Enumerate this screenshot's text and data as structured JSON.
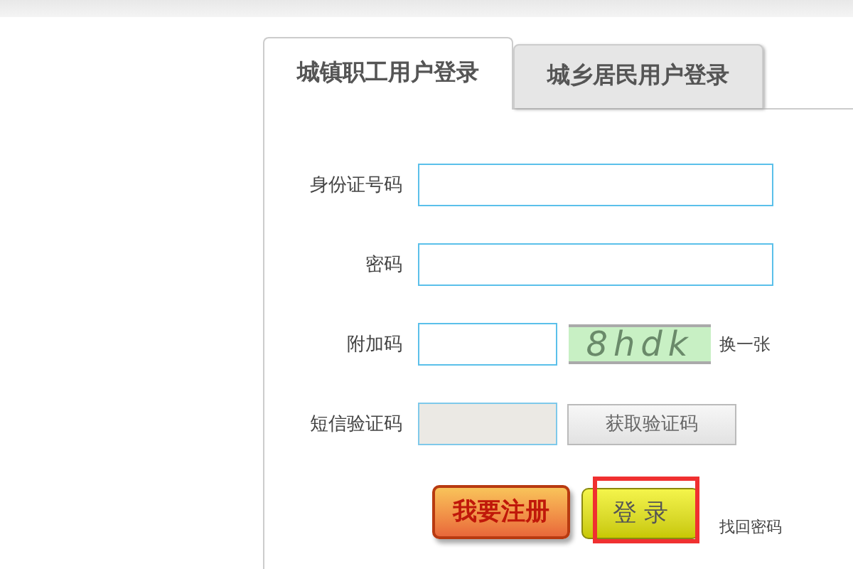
{
  "tabs": [
    {
      "label": "城镇职工用户登录",
      "selected": true
    },
    {
      "label": "城乡居民用户登录",
      "selected": false
    }
  ],
  "form": {
    "fields": [
      {
        "label": "身份证号码",
        "kind": "text",
        "disabled": false
      },
      {
        "label": "密码",
        "kind": "text",
        "disabled": false
      },
      {
        "label": "附加码",
        "kind": "captcha",
        "disabled": false,
        "captcha": "8hdk",
        "refresh": "换一张"
      },
      {
        "label": "短信验证码",
        "kind": "sms",
        "disabled": true,
        "button": "获取验证码"
      }
    ],
    "register": "我要注册",
    "login": "登 录",
    "login_highlighted": true,
    "forgot": "找回密码"
  }
}
